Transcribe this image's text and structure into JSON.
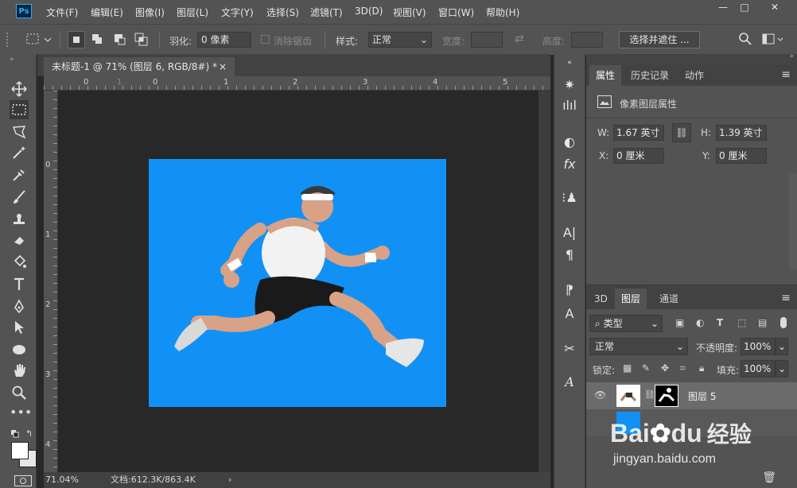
{
  "app": {
    "logo": "Ps",
    "menu": [
      "文件(F)",
      "编辑(E)",
      "图像(I)",
      "图层(L)",
      "文字(Y)",
      "选择(S)",
      "滤镜(T)",
      "3D(D)",
      "视图(V)",
      "窗口(W)",
      "帮助(H)"
    ],
    "window_controls": {
      "minimize": "—",
      "restore": "□",
      "close": "✕"
    }
  },
  "options": {
    "feather_label": "羽化:",
    "feather_value": "0 像素",
    "antialias_label": "消除锯齿",
    "style_label": "样式:",
    "style_value": "正常",
    "width_label": "宽度:",
    "height_label": "高度:",
    "select_mask_button": "选择并遮住 ..."
  },
  "document": {
    "tab_title": "未标题-1 @ 71% (图层 6, RGB/8#) *",
    "tab_close": "×",
    "ruler_top": [
      "0",
      "1",
      "0",
      "1",
      "2",
      "3",
      "4",
      "5"
    ],
    "ruler_left": [
      "0",
      "1",
      "2",
      "3",
      "4"
    ],
    "canvas_color": "#1191f5",
    "zoom": "71.04%",
    "doc_info": "文档:612.3K/863.4K"
  },
  "properties": {
    "tabs": [
      "属性",
      "历史记录",
      "动作"
    ],
    "title": "像素图层属性",
    "w_label": "W:",
    "w_value": "1.67 英寸",
    "h_label": "H:",
    "h_value": "1.39 英寸",
    "x_label": "X:",
    "x_value": "0 厘米",
    "y_label": "Y:",
    "y_value": "0 厘米"
  },
  "layers": {
    "tabs": [
      "3D",
      "图层",
      "通道"
    ],
    "filter_kind": "类型",
    "blend_mode": "正常",
    "opacity_label": "不透明度:",
    "opacity_value": "100%",
    "lock_label": "锁定:",
    "fill_label": "填充:",
    "fill_value": "100%",
    "layer_name": "图层 5"
  },
  "watermark": {
    "brand": "Bai",
    "brand2": "du",
    "cn": "经验",
    "url": "jingyan.baidu.com"
  },
  "colors": {
    "panel": "#535353",
    "canvas_bg": "#282828",
    "accent": "#31a8ff"
  }
}
